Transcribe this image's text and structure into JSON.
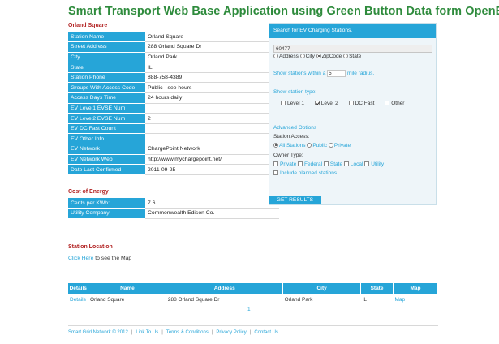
{
  "title": "Smart Transport Web Base Application using Green Button Data form OpenEI.",
  "station": {
    "heading": "Orland Square",
    "rows": [
      {
        "label": "Station Name",
        "value": "Orland Square"
      },
      {
        "label": "Street Address",
        "value": "288 Orland Square Dr"
      },
      {
        "label": "City",
        "value": "Orland Park"
      },
      {
        "label": "State",
        "value": "IL"
      },
      {
        "label": "Station Phone",
        "value": "888-758-4389"
      },
      {
        "label": "Groups With Access Code",
        "value": "Public - see hours"
      },
      {
        "label": "Access Days Time",
        "value": "24 hours daily"
      },
      {
        "label": "EV Level1 EVSE Num",
        "value": ""
      },
      {
        "label": "EV Level2 EVSE Num",
        "value": "2"
      },
      {
        "label": "EV DC Fast Count",
        "value": ""
      },
      {
        "label": "EV Other Info",
        "value": ""
      },
      {
        "label": "EV Network",
        "value": "ChargePoint Network"
      },
      {
        "label": "EV Network Web",
        "value": "http://www.mychargepoint.net/"
      },
      {
        "label": "Date Last Confirmed",
        "value": "2011-09-25"
      }
    ]
  },
  "energy": {
    "heading": "Cost of Energy",
    "rows": [
      {
        "label": "Cents per KWh:",
        "value": "7.6"
      },
      {
        "label": "Utility Company:",
        "value": "Commonwealth Edison Co."
      }
    ]
  },
  "search": {
    "heading": "Search for EV Charging Stations.",
    "query": "60477",
    "search_by": {
      "address": "Address",
      "city": "City",
      "zipcode": "ZipCode",
      "state": "State",
      "selected": "ZipCode"
    },
    "within_prefix": "Show stations within a",
    "radius": "5",
    "within_suffix": "mile radius.",
    "type_label": "Show station type:",
    "types": {
      "level1": "Level 1",
      "level2": "Level 2",
      "dcfast": "DC Fast",
      "other": "Other",
      "checked": "Level 2"
    },
    "advanced_label": "Advanced Options",
    "access_label": "Station Access:",
    "access": {
      "all": "All Stations",
      "public": "Public",
      "private": "Private",
      "selected": "All Stations"
    },
    "owner_label": "Owner Type:",
    "owners": {
      "private": "Private",
      "federal": "Federal",
      "state": "State",
      "local": "Local",
      "utility": "Utility"
    },
    "planned_label": "Include planned stations",
    "submit_label": "GET RESULTS"
  },
  "location": {
    "heading": "Station Location",
    "link_text": "Click Here",
    "rest_text": "to see the Map"
  },
  "results": {
    "headers": {
      "details": "Details",
      "name": "Name",
      "address": "Address",
      "city": "City",
      "state": "State",
      "map": "Map"
    },
    "row": {
      "details": "Details",
      "name": "Orland Square",
      "address": "288 Orland Square Dr",
      "city": "Orland Park",
      "state": "IL",
      "map": "Map"
    },
    "page": "1"
  },
  "footer": {
    "copyright": "Smart Grid Network © 2012",
    "link_to_us": "Link To Us",
    "terms": "Terms & Conditions",
    "privacy": "Privacy Policy",
    "contact": "Contact Us"
  },
  "colors": {
    "accent": "#26a5d8",
    "title_green": "#2e8b3c",
    "heading_red": "#b22222"
  }
}
